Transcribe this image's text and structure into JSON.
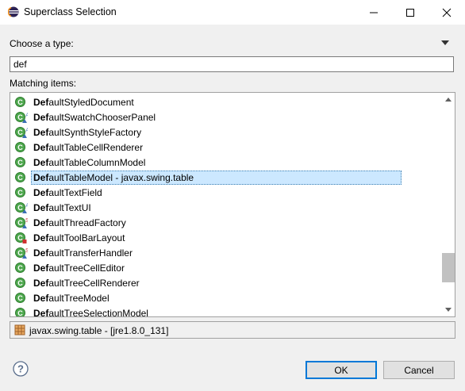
{
  "window": {
    "title": "Superclass Selection"
  },
  "form": {
    "type_label": "Choose a type:",
    "search_value": "def",
    "matching_label": "Matching items:"
  },
  "list": {
    "items": [
      {
        "bold": "Def",
        "rest": "aultStyledDocument",
        "icon": "class-icon"
      },
      {
        "bold": "Def",
        "rest": "aultSwatchChooserPanel",
        "icon": "abstract-class-icon"
      },
      {
        "bold": "Def",
        "rest": "aultSynthStyleFactory",
        "icon": "abstract-class-icon"
      },
      {
        "bold": "Def",
        "rest": "aultTableCellRenderer",
        "icon": "class-icon"
      },
      {
        "bold": "Def",
        "rest": "aultTableColumnModel",
        "icon": "class-icon"
      },
      {
        "bold": "Def",
        "rest": "aultTableModel - javax.swing.table",
        "icon": "class-icon",
        "selected": true
      },
      {
        "bold": "Def",
        "rest": "aultTextField",
        "icon": "class-icon"
      },
      {
        "bold": "Def",
        "rest": "aultTextUI",
        "icon": "abstract-class-icon"
      },
      {
        "bold": "Def",
        "rest": "aultThreadFactory",
        "icon": "static-nested-class-icon"
      },
      {
        "bold": "Def",
        "rest": "aultToolBarLayout",
        "icon": "private-nested-class-icon"
      },
      {
        "bold": "Def",
        "rest": "aultTransferHandler",
        "icon": "static-nested-class-icon"
      },
      {
        "bold": "Def",
        "rest": "aultTreeCellEditor",
        "icon": "class-icon"
      },
      {
        "bold": "Def",
        "rest": "aultTreeCellRenderer",
        "icon": "class-icon"
      },
      {
        "bold": "Def",
        "rest": "aultTreeModel",
        "icon": "class-icon"
      },
      {
        "bold": "Def",
        "rest": "aultTreeSelectionModel",
        "icon": "class-icon"
      }
    ]
  },
  "status": {
    "text": "javax.swing.table - [jre1.8.0_131]",
    "icon": "package-icon"
  },
  "buttons": {
    "ok": "OK",
    "cancel": "Cancel"
  }
}
